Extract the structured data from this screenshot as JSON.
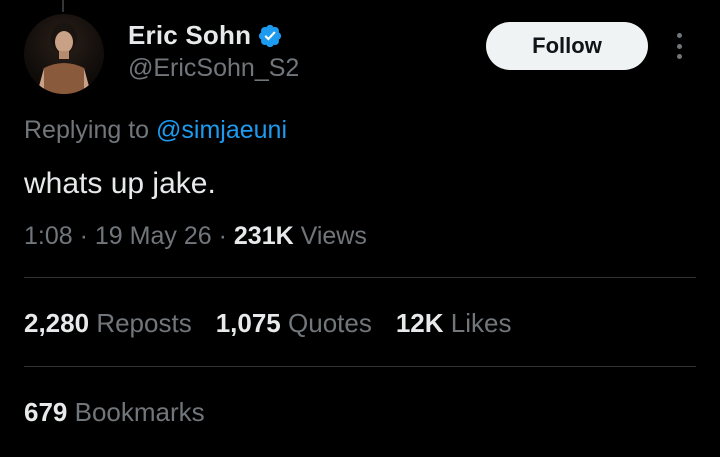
{
  "author": {
    "display_name": "Eric Sohn",
    "handle": "@EricSohn_S2",
    "verified_icon": "verified-badge-icon",
    "verified_color": "#1d9bf0"
  },
  "follow_button_label": "Follow",
  "more_icon": "more-options-icon",
  "replying": {
    "prefix": "Replying to ",
    "mention": "@simjaeuni"
  },
  "tweet": {
    "text": "whats up jake.",
    "time": "1:08",
    "separator": "·",
    "date": "19 May 26",
    "views_count": "231K",
    "views_label": "Views"
  },
  "stats": {
    "reposts": {
      "count": "2,280",
      "label": "Reposts"
    },
    "quotes": {
      "count": "1,075",
      "label": "Quotes"
    },
    "likes": {
      "count": "12K",
      "label": "Likes"
    },
    "bookmarks": {
      "count": "679",
      "label": "Bookmarks"
    }
  },
  "colors": {
    "background": "#000000",
    "primary_text": "#e7e9ea",
    "secondary_text": "#71767b",
    "link": "#1d9bf0",
    "divider": "#2f3336"
  }
}
